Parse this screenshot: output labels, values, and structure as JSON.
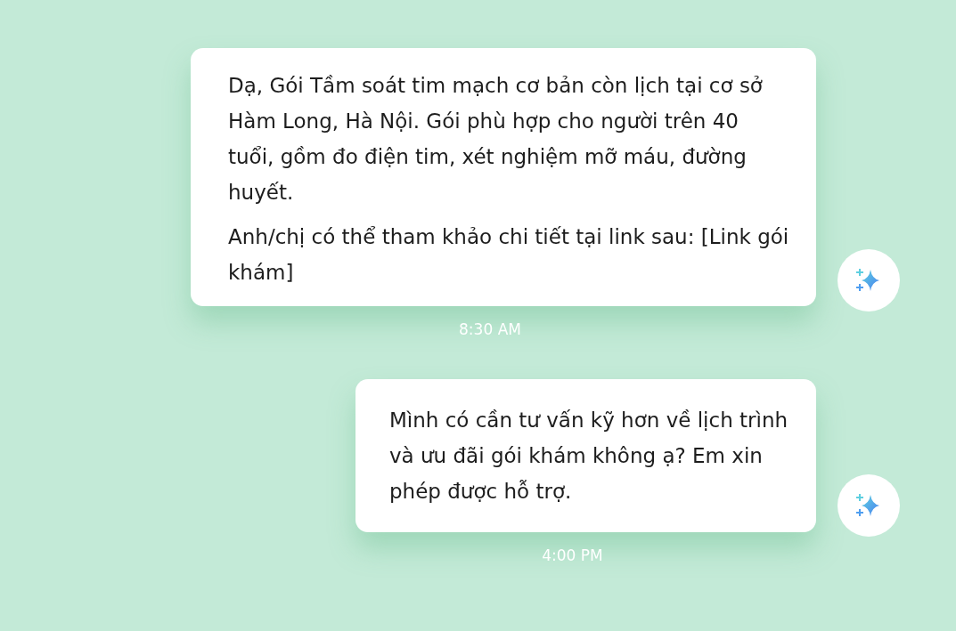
{
  "messages": [
    {
      "paragraphs": [
        "Dạ, Gói Tầm soát tim mạch cơ bản còn lịch tại cơ sở Hàm Long, Hà Nội. Gói phù hợp cho người trên 40 tuổi, gồm đo điện tim, xét nghiệm mỡ máu, đường huyết.",
        "Anh/chị có thể tham khảo chi tiết tại link sau: [Link gói khám]"
      ],
      "time": "8:30 AM"
    },
    {
      "paragraphs": [
        "Mình có cần tư vấn kỹ hơn về lịch trình và ưu đãi gói khám không ạ? Em xin phép được hỗ trợ."
      ],
      "time": "4:00 PM"
    }
  ]
}
